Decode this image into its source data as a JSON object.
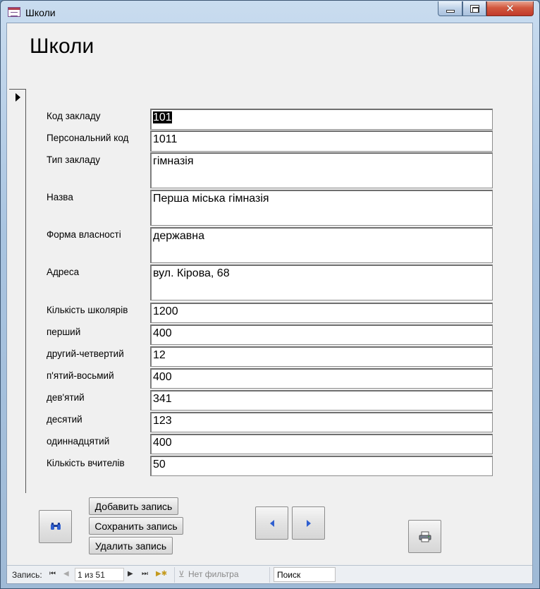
{
  "window": {
    "title": "Школи"
  },
  "form": {
    "title": "Школи",
    "fields": [
      {
        "label": "Код закладу",
        "value": "101"
      },
      {
        "label": "Персональний код",
        "value": "1011"
      },
      {
        "label": "Тип закладу",
        "value": "гімназія"
      },
      {
        "label": "Назва",
        "value": "Перша міська гімназія"
      },
      {
        "label": "Форма власності",
        "value": "державна"
      },
      {
        "label": "Адреса",
        "value": "вул. Кірова, 68"
      },
      {
        "label": "Кількість школярів",
        "value": "1200"
      },
      {
        "label": "перший",
        "value": "400"
      },
      {
        "label": "другий-четвертий",
        "value": "12"
      },
      {
        "label": "п'ятий-восьмий",
        "value": "400"
      },
      {
        "label": "дев'ятий",
        "value": "341"
      },
      {
        "label": "десятий",
        "value": "123"
      },
      {
        "label": "одиннадцятий",
        "value": "400"
      },
      {
        "label": "Кількість вчителів",
        "value": "50"
      }
    ]
  },
  "buttons": {
    "add": "Добавить запись",
    "save": "Сохранить запись",
    "delete": "Удалить запись"
  },
  "statusbar": {
    "record_label": "Запись:",
    "record_position": "1 из 51",
    "filter": "Нет фильтра",
    "search": "Поиск"
  },
  "icons": {
    "find": "binoculars-icon",
    "prev": "arrow-left-icon",
    "next": "arrow-right-icon",
    "print": "printer-icon"
  },
  "colors": {
    "accent_blue": "#2f5fd0",
    "client_bg": "#f0f0f0",
    "close_red": "#c0392b"
  }
}
